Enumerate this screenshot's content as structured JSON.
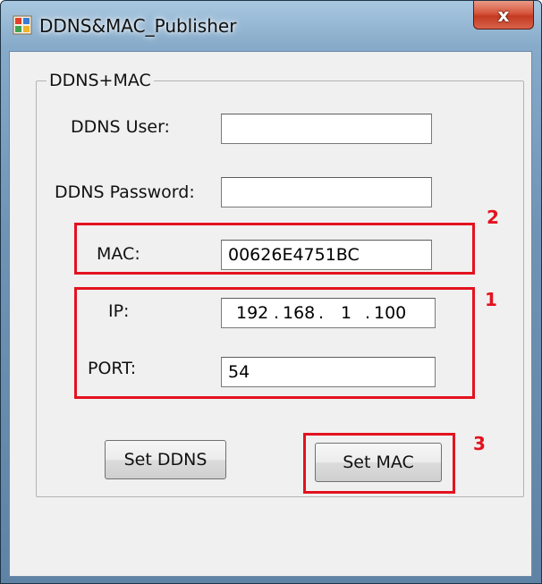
{
  "window": {
    "title": "DDNS&MAC_Publisher",
    "close_label": "x"
  },
  "group": {
    "label": "DDNS+MAC"
  },
  "form": {
    "ddns_user": {
      "label": "DDNS User:",
      "value": ""
    },
    "ddns_password": {
      "label": "DDNS Password:",
      "value": ""
    },
    "mac": {
      "label": "MAC:",
      "value": "00626E4751BC"
    },
    "ip": {
      "label": "IP:",
      "octets": [
        "192",
        "168",
        "1",
        "100"
      ]
    },
    "port": {
      "label": "PORT:",
      "value": "54"
    }
  },
  "buttons": {
    "set_ddns": "Set DDNS",
    "set_mac": "Set MAC"
  },
  "annotations": {
    "mac_marker": "2",
    "network_marker": "1",
    "set_mac_marker": "3",
    "color": "#e3121f"
  }
}
